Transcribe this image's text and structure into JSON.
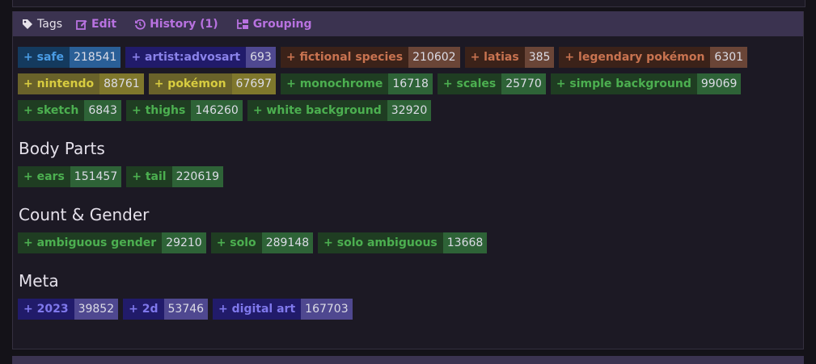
{
  "header": {
    "tags_label": "Tags",
    "edit_label": "Edit",
    "history_label": "History (1)",
    "grouping_label": "Grouping"
  },
  "colors": {
    "rating": {
      "bg": "#143a5e",
      "fg": "#4a9ce4",
      "count_bg": "#2a5f97"
    },
    "artist": {
      "bg": "#211b6a",
      "fg": "#8a82ea",
      "count_bg": "#4f4890"
    },
    "species": {
      "bg": "#3b2219",
      "fg": "#c87350",
      "count_bg": "#6a4537"
    },
    "origin": {
      "bg": "#69622a",
      "fg": "#d8cc40",
      "count_bg": "#7f772c"
    },
    "general": {
      "bg": "#1f3d22",
      "fg": "#4caf50",
      "count_bg": "#2e6337"
    },
    "meta": {
      "bg": "#211b6a",
      "fg": "#7f78ec",
      "count_bg": "#4f4890"
    }
  },
  "main_tags": [
    {
      "name": "+ safe",
      "count": "218541",
      "category": "rating"
    },
    {
      "name": "+ artist:advosart",
      "count": "693",
      "category": "artist"
    },
    {
      "name": "+ fictional species",
      "count": "210602",
      "category": "species"
    },
    {
      "name": "+ latias",
      "count": "385",
      "category": "species"
    },
    {
      "name": "+ legendary pokémon",
      "count": "6301",
      "category": "species"
    },
    {
      "name": "+ nintendo",
      "count": "88761",
      "category": "origin"
    },
    {
      "name": "+ pokémon",
      "count": "67697",
      "category": "origin"
    },
    {
      "name": "+ monochrome",
      "count": "16718",
      "category": "general"
    },
    {
      "name": "+ scales",
      "count": "25770",
      "category": "general"
    },
    {
      "name": "+ simple background",
      "count": "99069",
      "category": "general"
    },
    {
      "name": "+ sketch",
      "count": "6843",
      "category": "general"
    },
    {
      "name": "+ thighs",
      "count": "146260",
      "category": "general"
    },
    {
      "name": "+ white background",
      "count": "32920",
      "category": "general"
    }
  ],
  "groups": [
    {
      "title": "Body Parts",
      "tags": [
        {
          "name": "+ ears",
          "count": "151457",
          "category": "general"
        },
        {
          "name": "+ tail",
          "count": "220619",
          "category": "general"
        }
      ]
    },
    {
      "title": "Count & Gender",
      "tags": [
        {
          "name": "+ ambiguous gender",
          "count": "29210",
          "category": "general"
        },
        {
          "name": "+ solo",
          "count": "289148",
          "category": "general"
        },
        {
          "name": "+ solo ambiguous",
          "count": "13668",
          "category": "general"
        }
      ]
    },
    {
      "title": "Meta",
      "tags": [
        {
          "name": "+ 2023",
          "count": "39852",
          "category": "meta"
        },
        {
          "name": "+ 2d",
          "count": "53746",
          "category": "meta"
        },
        {
          "name": "+ digital art",
          "count": "167703",
          "category": "meta"
        }
      ]
    }
  ]
}
